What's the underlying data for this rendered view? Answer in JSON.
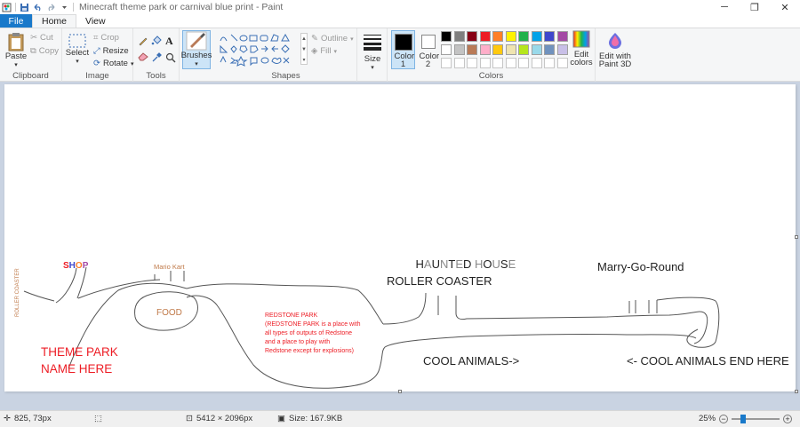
{
  "window": {
    "title": "Minecraft theme park or carnival blue print - Paint",
    "controls": {
      "minimize": "─",
      "restore": "❐",
      "close": "✕"
    }
  },
  "tabs": {
    "file": "File",
    "home": "Home",
    "view": "View"
  },
  "ribbon": {
    "clipboard": {
      "label": "Clipboard",
      "paste": "Paste",
      "cut": "Cut",
      "copy": "Copy"
    },
    "image": {
      "label": "Image",
      "select": "Select",
      "crop": "Crop",
      "resize": "Resize",
      "rotate": "Rotate"
    },
    "tools": {
      "label": "Tools",
      "brushes": "Brushes"
    },
    "shapes": {
      "label": "Shapes",
      "outline": "Outline",
      "fill": "Fill"
    },
    "size": {
      "label": "Size"
    },
    "colors": {
      "label": "Colors",
      "color1": "Color 1",
      "color2": "Color 2",
      "edit_colors": "Edit colors",
      "palette_row1": [
        "#000000",
        "#7f7f7f",
        "#880015",
        "#ed1c24",
        "#ff7f27",
        "#fff200",
        "#22b14c",
        "#00a2e8",
        "#3f48cc",
        "#a349a4"
      ],
      "palette_row2": [
        "#ffffff",
        "#c3c3c3",
        "#b97a57",
        "#ffaec9",
        "#ffc90e",
        "#efe4b0",
        "#b5e61d",
        "#99d9ea",
        "#7092be",
        "#c8bfe7"
      ]
    },
    "paint3d": {
      "label": "Edit with Paint 3D"
    }
  },
  "drawing": {
    "shop": [
      "S",
      "H",
      "O",
      "P"
    ],
    "shop_colors": [
      "#ed1c24",
      "#3f48cc",
      "#ff7f27",
      "#a349a4"
    ],
    "roller_coaster_side": "ROLLER COASTER",
    "mario_kart": "Mario Kart",
    "food": "FOOD",
    "theme_park_line1": "THEME PARK",
    "theme_park_line2": "NAME HERE",
    "redstone_title": "REDSTONE PARK",
    "redstone_desc": [
      "(REDSTONE PARK is a place with",
      "all types of outputs of Redstone",
      "and a place to play with",
      "Redstone except for explosions)"
    ],
    "haunted_letters": [
      "H",
      "A",
      "U",
      "N",
      "T",
      "E",
      "D",
      " ",
      "H",
      "O",
      "U",
      "S",
      "E"
    ],
    "haunted_colors": [
      "#222222",
      "#888888",
      "#222222",
      "#888888",
      "#222222",
      "#888888",
      "#222222",
      "#222222",
      "#888888",
      "#222222",
      "#888888",
      "#222222",
      "#888888"
    ],
    "roller_coaster": "ROLLER COASTER",
    "marry_go_round": "Marry-Go-Round",
    "cool_animals": "COOL ANIMALS->",
    "cool_animals_end": "<- COOL ANIMALS END HERE"
  },
  "status": {
    "cursor": "825, 73px",
    "dimensions": "5412 × 2096px",
    "size": "Size: 167.9KB",
    "zoom": "25%"
  }
}
